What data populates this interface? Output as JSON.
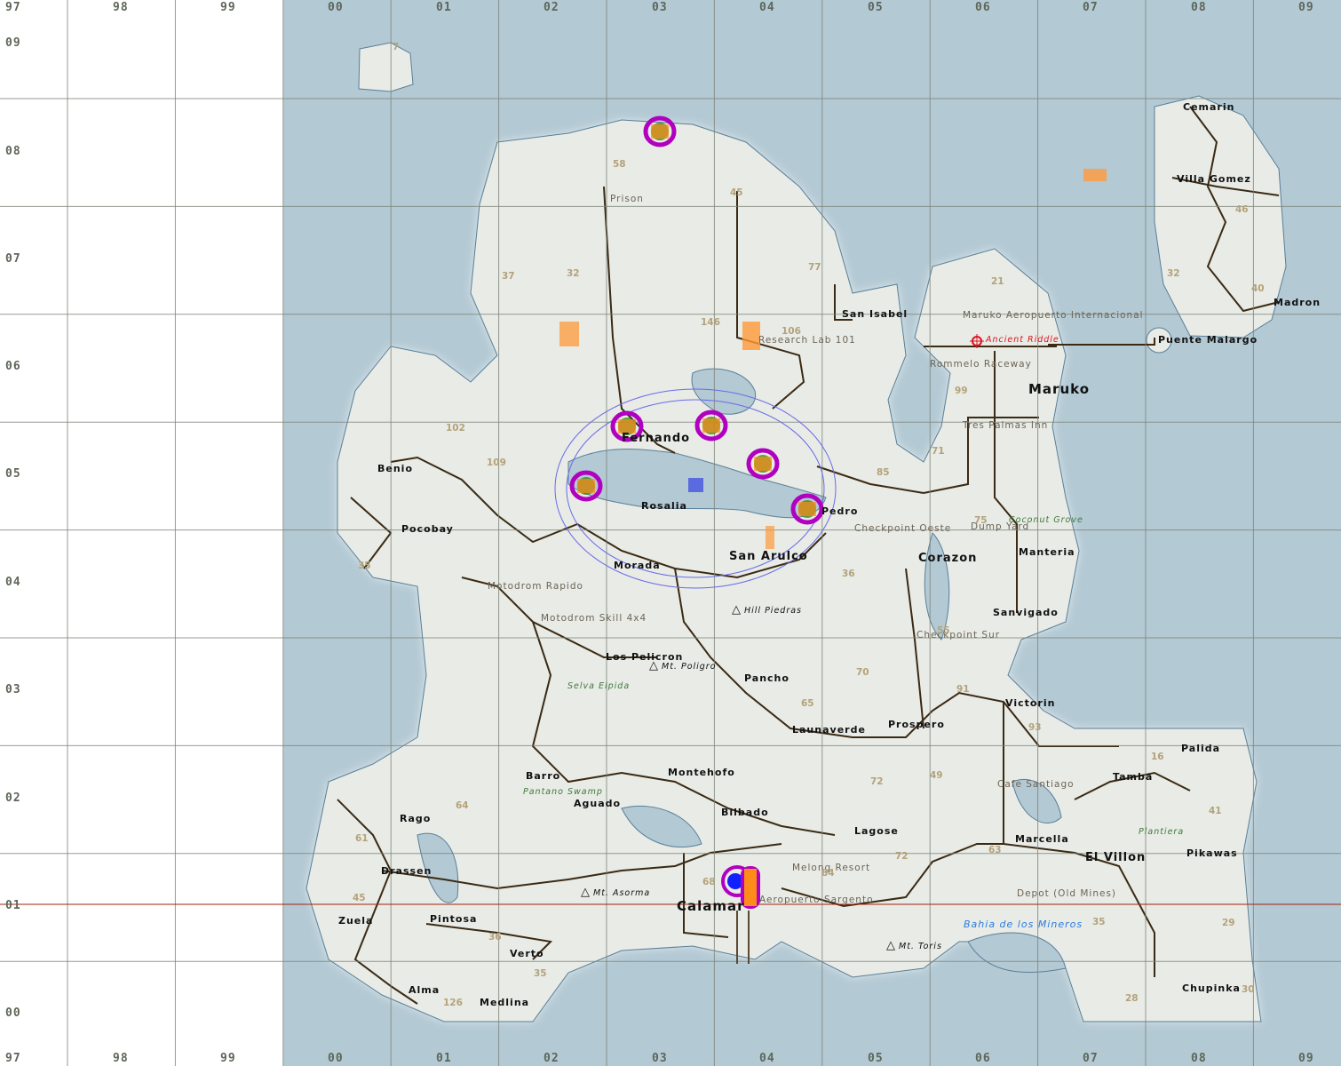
{
  "map": {
    "colors": {
      "water": "#b3c9d4",
      "land": "#e8ebe6",
      "road": "#3b2a14",
      "grid": "#7d8478",
      "height": "#b4a27a",
      "marker": "#b000c0",
      "marker_fill": "#ff8c1a",
      "range": "#6a6ae8"
    },
    "grid": {
      "columns": [
        "97",
        "98",
        "99",
        "00",
        "01",
        "02",
        "03",
        "04",
        "05",
        "06",
        "07",
        "08",
        "09"
      ],
      "rows": [
        "09",
        "08",
        "07",
        "06",
        "05",
        "04",
        "03",
        "02",
        "01",
        "00"
      ]
    },
    "towns": [
      "Cemarin",
      "Villa Gomez",
      "Madron",
      "Puente Malargo",
      "San Isabel",
      "Maruko",
      "Benio",
      "Pocobay",
      "Fernando",
      "Rosalia",
      "Morada",
      "San Arulco",
      "Corazon",
      "Manteria",
      "Sanvigado",
      "Los Pelicron",
      "Pancho",
      "Victorin",
      "Prospero",
      "Launaverde",
      "Palida",
      "Tamba",
      "Barro",
      "Montehofo",
      "Aguado",
      "Bilbado",
      "Rago",
      "Lagose",
      "Marcella",
      "El Villon",
      "Pikawas",
      "Drassen",
      "Calamar",
      "Zuela",
      "Pintosa",
      "Verto",
      "Alma",
      "Medlina",
      "Chupinka",
      "Pedro"
    ],
    "locations": [
      "Prison",
      "Research Lab 101",
      "Maruko Aeropuerto Internacional",
      "Rommelo Raceway",
      "Tres Palmas Inn",
      "Checkpoint Oeste",
      "Dump Yard",
      "Motodrom Rapido",
      "Motodrom Skill 4x4",
      "Checkpoint Sur",
      "Cafe Santiago",
      "Melong Resort",
      "Aeropuerto Sargento",
      "Depot (Old Mines)"
    ],
    "poi_red": [
      "Ancient Riddle"
    ],
    "vegetation": [
      "Coconut Grove",
      "Selva Elpida",
      "Pantano Swamp",
      "Plantiera"
    ],
    "water_names": [
      "Bahia de los Mineros"
    ],
    "mountains": [
      "Hill Piedras",
      "Mt. Poligro",
      "Mt. Asorma",
      "Mt. Toris"
    ],
    "heights": [
      "7",
      "58",
      "45",
      "37",
      "32",
      "77",
      "146",
      "106",
      "21",
      "46",
      "32",
      "40",
      "102",
      "109",
      "85",
      "71",
      "75",
      "35",
      "36",
      "55",
      "70",
      "91",
      "65",
      "93",
      "16",
      "72",
      "49",
      "64",
      "61",
      "63",
      "41",
      "72",
      "68",
      "84",
      "45",
      "36",
      "35",
      "126",
      "35",
      "29",
      "28",
      "30",
      "99"
    ]
  }
}
